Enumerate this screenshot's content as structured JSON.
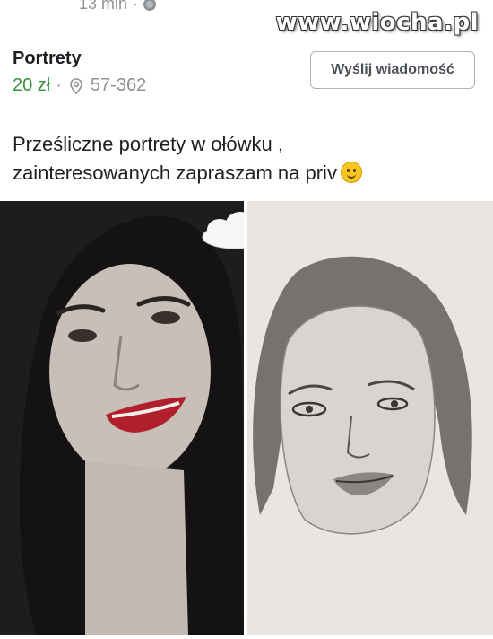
{
  "post": {
    "time": "13 min",
    "watermark": "www.wiocha.pl"
  },
  "listing": {
    "title": "Portrety",
    "price": "20 zł",
    "location": "57-362",
    "message_button": "Wyślij wiadomość",
    "description_line1": "Prześliczne portrety w ołówku ,",
    "description_line2": "zainteresowanych zapraszam na priv"
  },
  "colors": {
    "price_green": "#3a8f3a",
    "meta_gray": "#8e9297",
    "button_border": "#b0b3b8"
  },
  "icons": {
    "time_globe": "globe-icon",
    "location": "location-pin-icon",
    "emoji": "smiley-emoji-icon",
    "sticker": "cloud-sticker-icon"
  }
}
